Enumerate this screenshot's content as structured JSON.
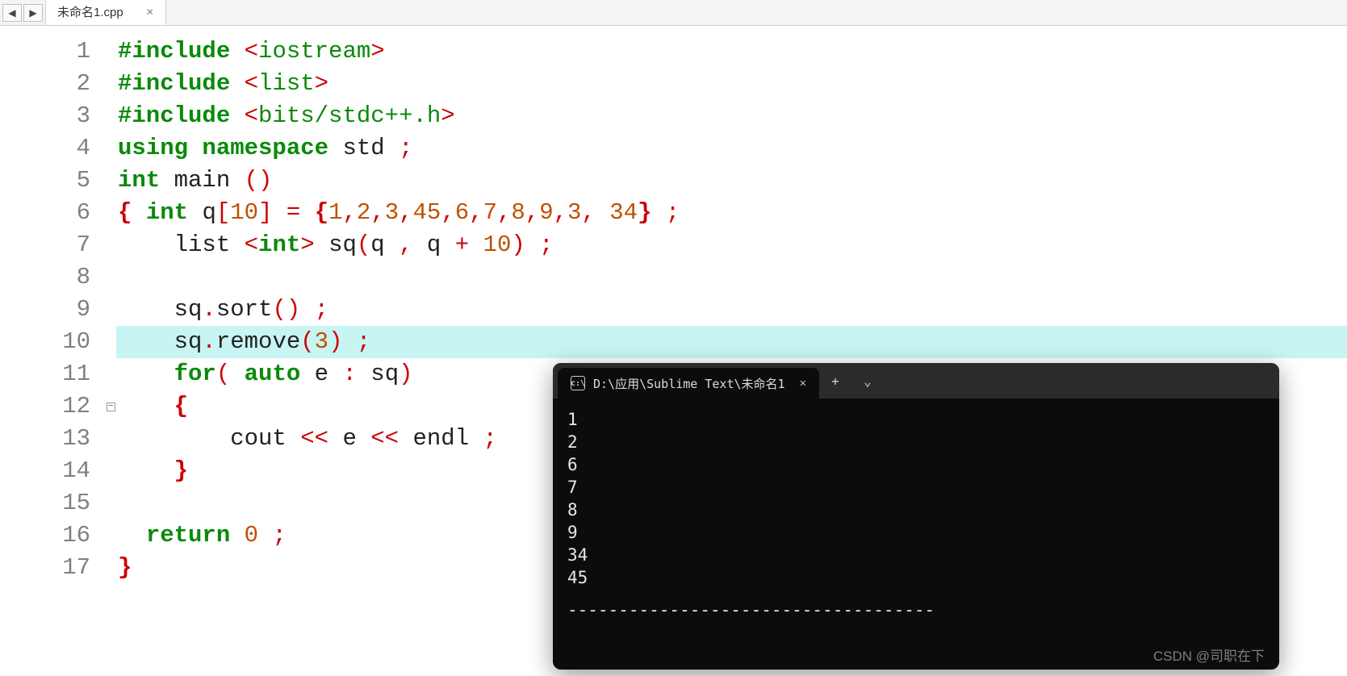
{
  "tabbar": {
    "tab_title": "未命名1.cpp"
  },
  "nav": {
    "prev": "◀",
    "next": "▶"
  },
  "code": {
    "highlight_line": 10,
    "lines": [
      {
        "n": 1,
        "tokens": [
          [
            "dir",
            "#include "
          ],
          [
            "pun",
            "<"
          ],
          [
            "hdr",
            "iostream"
          ],
          [
            "pun",
            ">"
          ]
        ]
      },
      {
        "n": 2,
        "tokens": [
          [
            "dir",
            "#include "
          ],
          [
            "pun",
            "<"
          ],
          [
            "hdr",
            "list"
          ],
          [
            "pun",
            ">"
          ]
        ]
      },
      {
        "n": 3,
        "tokens": [
          [
            "dir",
            "#include "
          ],
          [
            "pun",
            "<"
          ],
          [
            "hdr",
            "bits/stdc++.h"
          ],
          [
            "pun",
            ">"
          ]
        ]
      },
      {
        "n": 4,
        "tokens": [
          [
            "kw",
            "using "
          ],
          [
            "kw",
            "namespace "
          ],
          [
            "id",
            "std "
          ],
          [
            "pun",
            ";"
          ]
        ]
      },
      {
        "n": 5,
        "tokens": [
          [
            "kw",
            "int "
          ],
          [
            "fn",
            "main "
          ],
          [
            "pun",
            "()"
          ]
        ]
      },
      {
        "n": 6,
        "tokens": [
          [
            "brace",
            "{ "
          ],
          [
            "kw",
            "int "
          ],
          [
            "id",
            "q"
          ],
          [
            "pun",
            "["
          ],
          [
            "num",
            "10"
          ],
          [
            "pun",
            "]"
          ],
          [
            "id",
            " "
          ],
          [
            "pun",
            "="
          ],
          [
            "id",
            " "
          ],
          [
            "brace",
            "{"
          ],
          [
            "num",
            "1"
          ],
          [
            "pun",
            ","
          ],
          [
            "num",
            "2"
          ],
          [
            "pun",
            ","
          ],
          [
            "num",
            "3"
          ],
          [
            "pun",
            ","
          ],
          [
            "num",
            "45"
          ],
          [
            "pun",
            ","
          ],
          [
            "num",
            "6"
          ],
          [
            "pun",
            ","
          ],
          [
            "num",
            "7"
          ],
          [
            "pun",
            ","
          ],
          [
            "num",
            "8"
          ],
          [
            "pun",
            ","
          ],
          [
            "num",
            "9"
          ],
          [
            "pun",
            ","
          ],
          [
            "num",
            "3"
          ],
          [
            "pun",
            ","
          ],
          [
            "id",
            " "
          ],
          [
            "num",
            "34"
          ],
          [
            "brace",
            "}"
          ],
          [
            "id",
            " "
          ],
          [
            "pun",
            ";"
          ]
        ]
      },
      {
        "n": 7,
        "tokens": [
          [
            "id",
            "    list "
          ],
          [
            "pun",
            "<"
          ],
          [
            "kw",
            "int"
          ],
          [
            "pun",
            ">"
          ],
          [
            "id",
            " sq"
          ],
          [
            "pun",
            "("
          ],
          [
            "id",
            "q "
          ],
          [
            "pun",
            ","
          ],
          [
            "id",
            " q "
          ],
          [
            "pun",
            "+"
          ],
          [
            "id",
            " "
          ],
          [
            "num",
            "10"
          ],
          [
            "pun",
            ")"
          ],
          [
            "id",
            " "
          ],
          [
            "pun",
            ";"
          ]
        ]
      },
      {
        "n": 8,
        "tokens": [
          [
            "id",
            " "
          ]
        ]
      },
      {
        "n": 9,
        "tokens": [
          [
            "id",
            "    sq"
          ],
          [
            "pun",
            "."
          ],
          [
            "id",
            "sort"
          ],
          [
            "pun",
            "()"
          ],
          [
            "id",
            " "
          ],
          [
            "pun",
            ";"
          ]
        ]
      },
      {
        "n": 10,
        "tokens": [
          [
            "id",
            "    sq"
          ],
          [
            "pun",
            "."
          ],
          [
            "id",
            "remove"
          ],
          [
            "pun",
            "("
          ],
          [
            "num",
            "3"
          ],
          [
            "pun",
            ")"
          ],
          [
            "id",
            " "
          ],
          [
            "pun",
            ";"
          ]
        ]
      },
      {
        "n": 11,
        "tokens": [
          [
            "id",
            "    "
          ],
          [
            "kw",
            "for"
          ],
          [
            "pun",
            "("
          ],
          [
            "id",
            " "
          ],
          [
            "kw",
            "auto "
          ],
          [
            "id",
            "e "
          ],
          [
            "pun",
            ":"
          ],
          [
            "id",
            " sq"
          ],
          [
            "pun",
            ")"
          ]
        ]
      },
      {
        "n": 12,
        "fold": true,
        "tokens": [
          [
            "id",
            "    "
          ],
          [
            "brace",
            "{"
          ]
        ]
      },
      {
        "n": 13,
        "tokens": [
          [
            "id",
            "        cout "
          ],
          [
            "pun",
            "<<"
          ],
          [
            "id",
            " e "
          ],
          [
            "pun",
            "<<"
          ],
          [
            "id",
            " endl "
          ],
          [
            "pun",
            ";"
          ]
        ]
      },
      {
        "n": 14,
        "tokens": [
          [
            "id",
            "    "
          ],
          [
            "brace",
            "}"
          ]
        ]
      },
      {
        "n": 15,
        "tokens": [
          [
            "id",
            " "
          ]
        ]
      },
      {
        "n": 16,
        "tokens": [
          [
            "id",
            "  "
          ],
          [
            "kw",
            "return "
          ],
          [
            "num",
            "0"
          ],
          [
            "id",
            " "
          ],
          [
            "pun",
            ";"
          ]
        ]
      },
      {
        "n": 17,
        "tokens": [
          [
            "brace",
            "}"
          ]
        ]
      }
    ]
  },
  "terminal": {
    "tab_title": "D:\\应用\\Sublime Text\\未命名1",
    "icon_text": "c:\\",
    "output": [
      "1",
      "2",
      "6",
      "7",
      "8",
      "9",
      "34",
      "45"
    ],
    "dashes": "------------------------------------",
    "watermark": "CSDN @司职在下",
    "plus": "+",
    "chev": "⌄"
  }
}
